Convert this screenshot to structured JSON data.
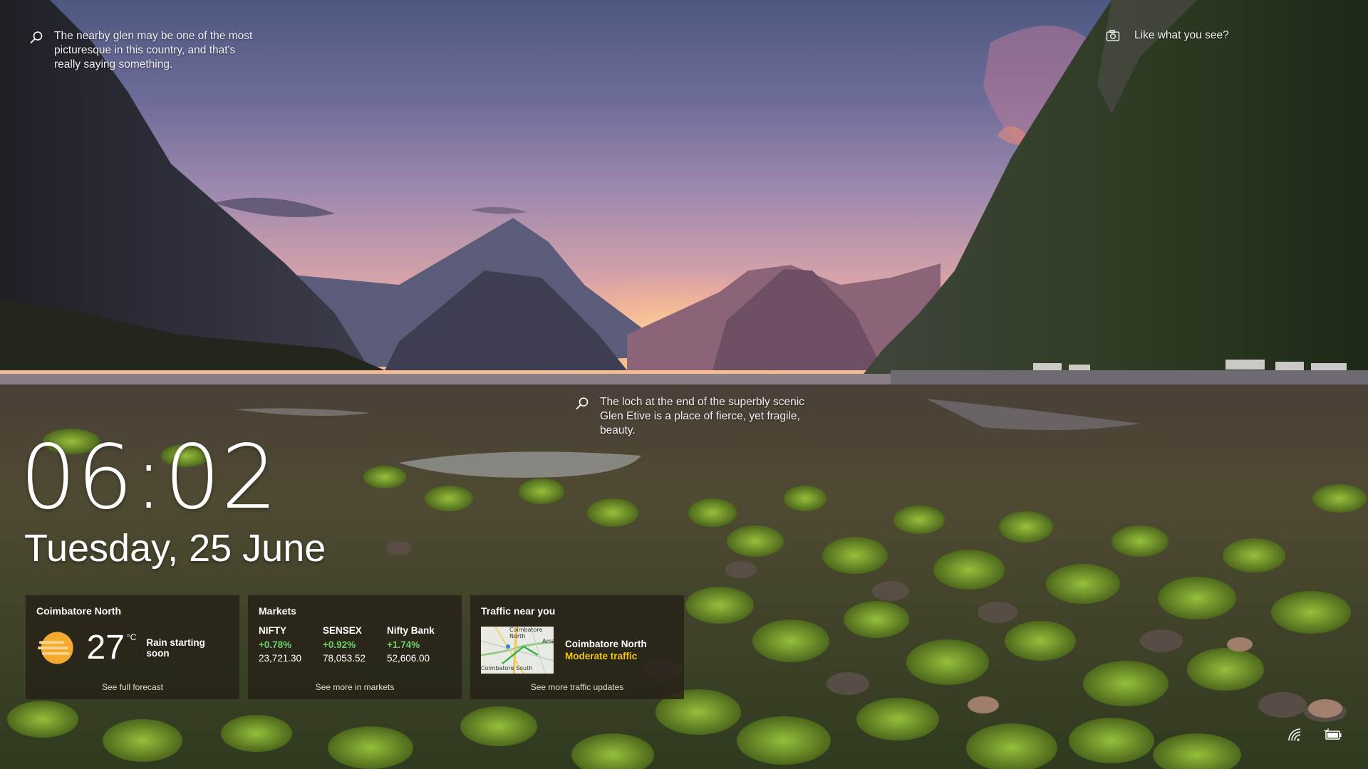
{
  "hotspots": [
    {
      "text": "The nearby glen may be one of the most picturesque in this country, and that's really saying something.",
      "icon": "search-icon"
    },
    {
      "text": "The loch at the end of the superbly scenic Glen Etive is a place of fierce, yet fragile, beauty.",
      "icon": "search-icon"
    }
  ],
  "feedback": {
    "label": "Like what you see?",
    "icon": "camera-icon"
  },
  "clock": {
    "time": "06:02",
    "date": "Tuesday, 25 June"
  },
  "weather": {
    "location": "Coimbatore North",
    "temperature": "27",
    "unit": "°C",
    "condition": "Rain starting soon",
    "icon": "sun-haze-icon",
    "link": "See full forecast"
  },
  "markets": {
    "title": "Markets",
    "indices": [
      {
        "name": "NIFTY",
        "change": "+0.78%",
        "value": "23,721.30"
      },
      {
        "name": "SENSEX",
        "change": "+0.92%",
        "value": "78,053.52"
      },
      {
        "name": "Nifty Bank",
        "change": "+1.74%",
        "value": "52,606.00"
      }
    ],
    "positive_color": "#6cd26c",
    "link": "See more in markets"
  },
  "traffic": {
    "title": "Traffic near you",
    "place": "Coimbatore North",
    "status": "Moderate traffic",
    "status_color": "#f0c418",
    "map_labels": [
      "Coimbatore North",
      "Coimbatore South",
      "Ama"
    ],
    "link": "See more traffic updates"
  },
  "tray": {
    "icons": [
      "network-icon",
      "battery-icon"
    ]
  }
}
